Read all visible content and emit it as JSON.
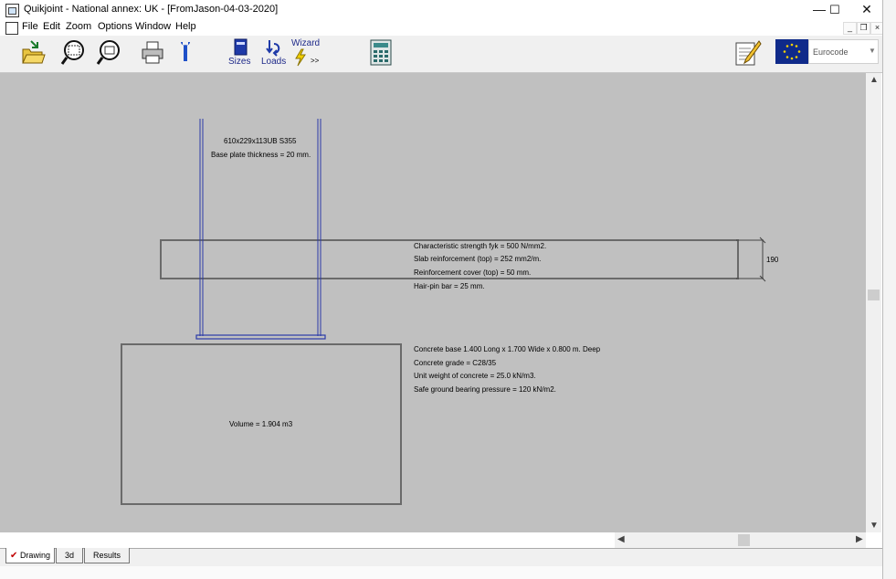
{
  "window": {
    "title": "Quikjoint - National annex: UK - [FromJason-04-03-2020]",
    "minimize_glyph": "—",
    "maximize_glyph": "☐",
    "close_glyph": "✕"
  },
  "menu": {
    "items": [
      "File",
      "Edit",
      "Zoom",
      "Options",
      "Window",
      "Help"
    ],
    "mdi_minimize": "_",
    "mdi_restore": "❐",
    "mdi_close": "×"
  },
  "toolbar": {
    "sizes_label": "Sizes",
    "loads_label": "Loads",
    "wizard_label": "Wizard",
    "wizard_more": ">>",
    "code_selected": "Eurocode",
    "icons": [
      "open-folder-icon",
      "zoom-window-icon",
      "zoom-out-icon",
      "printer-icon",
      "tools-icon",
      "sizes-book-icon",
      "loads-arrows-icon",
      "wizard-lightning-icon",
      "calculator-icon",
      "edit-notepad-icon",
      "eu-flag-icon"
    ]
  },
  "drawing": {
    "section_label": "610x229x113UB S355",
    "base_plate_label": "Base plate thickness = 20 mm.",
    "slab_notes": [
      "Characteristic strength fyk = 500 N/mm2.",
      "Slab reinforcement (top) = 252 mm2/m.",
      "Reinforcement cover (top) = 50 mm.",
      "Hair-pin bar = 25 mm."
    ],
    "slab_dimension": "190",
    "base_notes": [
      "Concrete base 1.400 Long x 1.700 Wide x 0.800 m. Deep",
      "Concrete grade = C28/35",
      "Unit weight of concrete = 25.0 kN/m3.",
      "Safe ground bearing pressure = 120 kN/m2."
    ],
    "volume_label": "Volume = 1.904 m3"
  },
  "tabs": {
    "drawing": "Drawing",
    "threed": "3d",
    "results": "Results",
    "active": "Drawing"
  },
  "colors": {
    "canvas": "#c0c0c0",
    "column": "#2b3aa8",
    "outline": "#6a6a6a"
  }
}
